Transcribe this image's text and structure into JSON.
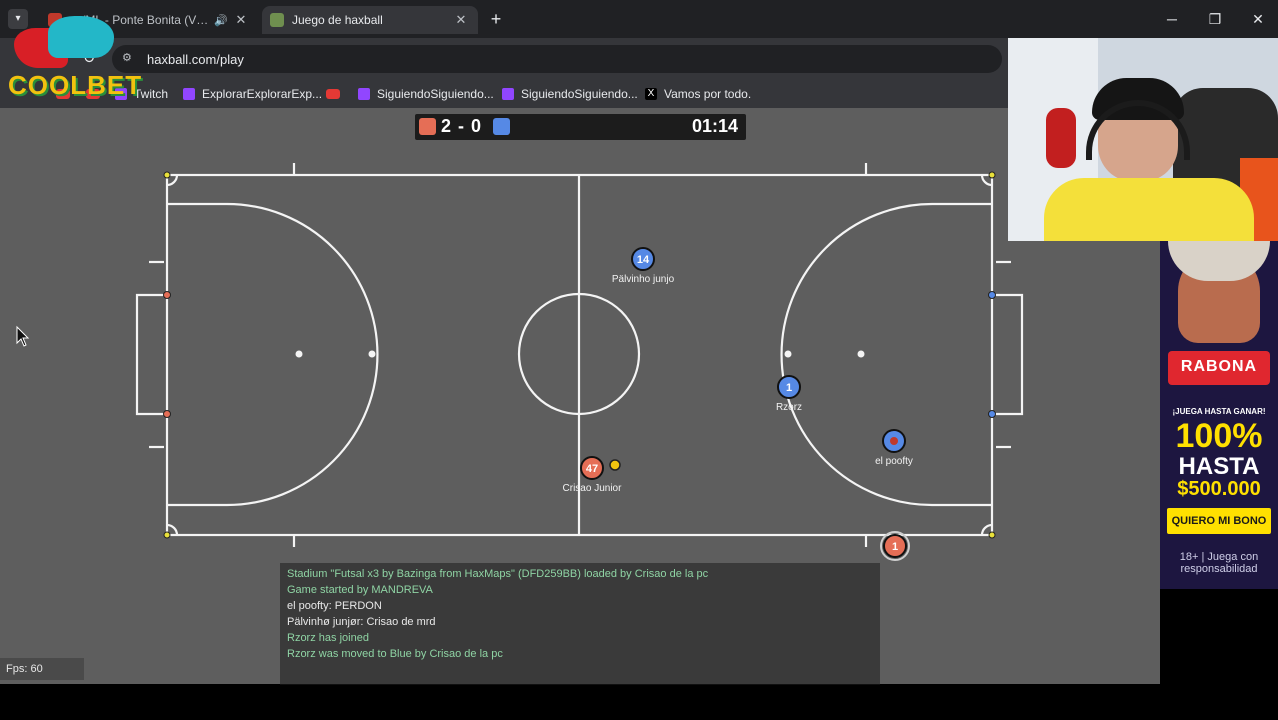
{
  "browser": {
    "tabs": [
      {
        "title": "…/ML - Ponte Bonita (V…",
        "active": false
      },
      {
        "title": "Juego de haxball",
        "active": true
      }
    ],
    "new_tab_label": "+",
    "url": "haxball.com/play",
    "bookmarks": [
      "Twitch",
      "ExplorarExplorarExp...",
      "SiguiendoSiguiendo...",
      "SiguiendoSiguiendo...",
      "Vamos por todo."
    ]
  },
  "scoreboard": {
    "score": "2 - 0",
    "time": "01:14",
    "red_color": "#e56e56",
    "blue_color": "#5689e5"
  },
  "players": [
    {
      "number": "14",
      "name": "Pälvinho junjo",
      "team": "blue"
    },
    {
      "number": "1",
      "name": "Rzorz",
      "team": "blue"
    },
    {
      "number": "47",
      "name": "Crisao Junior",
      "team": "red"
    },
    {
      "number": "",
      "name": "el poofty",
      "team": "blue"
    },
    {
      "number": "1",
      "name": "",
      "team": "red"
    }
  ],
  "chat": [
    {
      "text": "Stadium \"Futsal x3 by Bazinga from HaxMaps\" (DFD259BB) loaded by Crisao de la pc",
      "kind": "system"
    },
    {
      "text": "Game started by MANDREVA",
      "kind": "system"
    },
    {
      "text": "el poofty: PERDON",
      "kind": "player"
    },
    {
      "text": "Pälvinhø junjør: Crisao de mrd",
      "kind": "player"
    },
    {
      "text": "Rzorz has joined",
      "kind": "system"
    },
    {
      "text": "Rzorz was moved to Blue by Crisao de la pc",
      "kind": "system"
    }
  ],
  "fps": "Fps: 60",
  "overlay": {
    "logo": "COOLBET",
    "ad": {
      "brand": "RABONA",
      "line1": "¡JUEGA HASTA GANAR!",
      "line2": "100%",
      "line3": "HASTA",
      "line4": "$500.000",
      "button": "QUIERO MI BONO",
      "footer": "18+ | Juega con responsabilidad"
    }
  }
}
